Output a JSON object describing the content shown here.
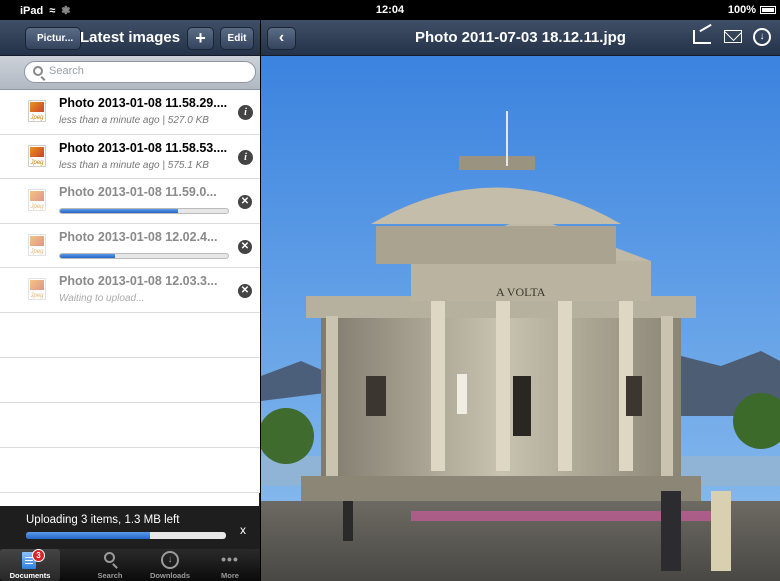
{
  "status_bar": {
    "device": "iPad",
    "time": "12:04",
    "battery": "100%"
  },
  "left_nav": {
    "back_label": "Pictur...",
    "title": "Latest images",
    "add_label": "+",
    "edit_label": "Edit"
  },
  "search": {
    "placeholder": "Search",
    "value": ""
  },
  "files": [
    {
      "name": "Photo 2013-01-08 11.58.29....",
      "subtitle": "less than a minute ago | 527.0 KB",
      "state": "done",
      "ext": "Jpeg"
    },
    {
      "name": "Photo 2013-01-08 11.58.53....",
      "subtitle": "less than a minute ago | 575.1 KB",
      "state": "done",
      "ext": "Jpeg"
    },
    {
      "name": "Photo 2013-01-08 11.59.0...",
      "subtitle": "",
      "state": "uploading",
      "progress": 0.7,
      "ext": "Jpeg"
    },
    {
      "name": "Photo 2013-01-08 12.02.4...",
      "subtitle": "",
      "state": "uploading",
      "progress": 0.33,
      "ext": "Jpeg"
    },
    {
      "name": "Photo 2013-01-08 12.03.3...",
      "subtitle": "Waiting to upload...",
      "state": "waiting",
      "ext": "Jpeg"
    }
  ],
  "upload_bar": {
    "text": "Uploading 3 items, 1.3 MB left",
    "close_label": "x",
    "progress": 0.62
  },
  "tabs": [
    {
      "label": "Documents",
      "badge": "3",
      "active": true
    },
    {
      "label": "Search"
    },
    {
      "label": "Downloads"
    },
    {
      "label": "More"
    }
  ],
  "viewer": {
    "title": "Photo 2011-07-03 18.12.11.jpg",
    "back_label": "<",
    "photo_inscription": "A VOLTA"
  },
  "colors": {
    "nav_bar": "#2f3e56",
    "progress_fill": "#2f78d6",
    "sky": "#4a8fe0"
  }
}
